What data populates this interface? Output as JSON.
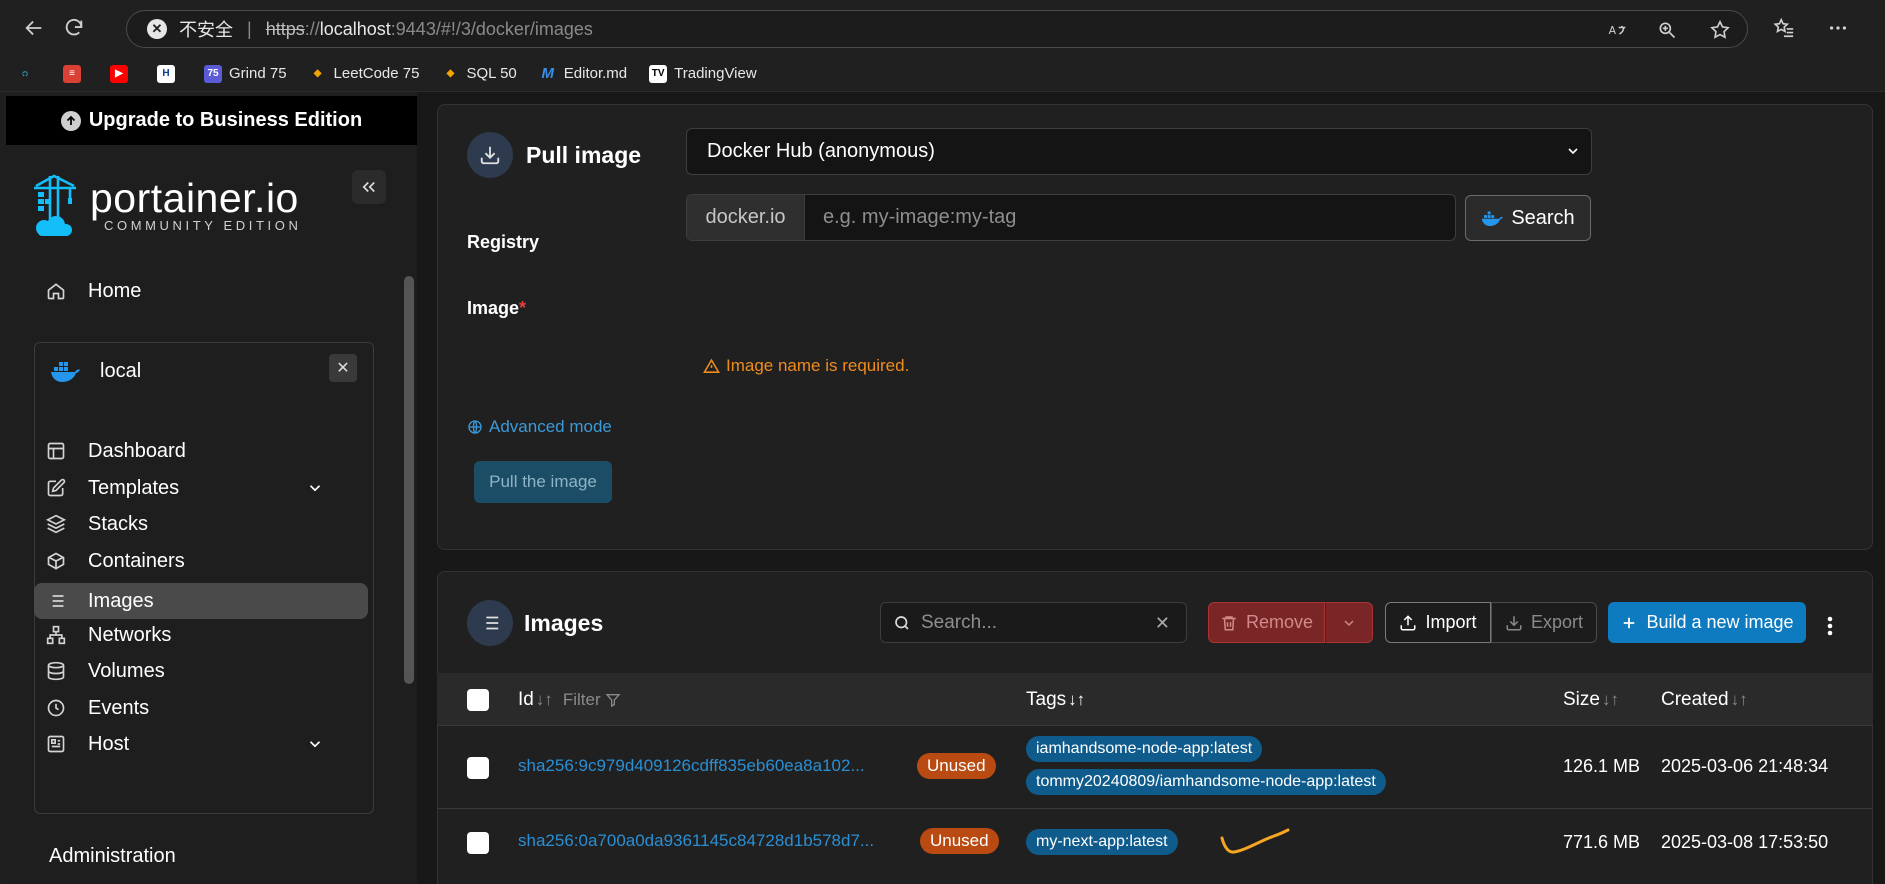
{
  "browser": {
    "security_warning": "不安全",
    "url_scheme": "https",
    "url_sep": "://",
    "url_host": "localhost",
    "url_rest": ":9443/#!/3/docker/images",
    "bookmarks": [
      "Grind 75",
      "LeetCode 75",
      "SQL 50",
      "Editor.md",
      "TradingView"
    ]
  },
  "sidebar": {
    "upgrade_label": "Upgrade to Business Edition",
    "logo_main": "portainer.io",
    "logo_sub": "COMMUNITY EDITION",
    "home": "Home",
    "environment": "local",
    "items": [
      "Dashboard",
      "Templates",
      "Stacks",
      "Containers",
      "Images",
      "Networks",
      "Volumes",
      "Events",
      "Host"
    ],
    "active_item": "Images",
    "admin_heading": "Administration"
  },
  "pull_panel": {
    "title": "Pull image",
    "registry_label": "Registry",
    "registry_value": "Docker Hub (anonymous)",
    "image_label": "Image",
    "required_mark": "*",
    "image_prefix": "docker.io",
    "image_placeholder": "e.g. my-image:my-tag",
    "image_value": "",
    "search_label": "Search",
    "error_text": "Image name is required.",
    "advanced_label": "Advanced mode",
    "pull_button": "Pull the image"
  },
  "images_panel": {
    "title": "Images",
    "search_placeholder": "Search...",
    "remove_label": "Remove",
    "import_label": "Import",
    "export_label": "Export",
    "build_label": "Build a new image",
    "columns": {
      "id": "Id",
      "filter": "Filter",
      "tags": "Tags",
      "size": "Size",
      "created": "Created"
    },
    "sort_glyph": "↓↑",
    "rows": [
      {
        "id": "sha256:9c979d409126cdff835eb60ea8a102...",
        "badge": "Unused",
        "tags": [
          "iamhandsome-node-app:latest",
          "tommy20240809/iamhandsome-node-app:latest"
        ],
        "size": "126.1 MB",
        "created": "2025-03-06 21:48:34"
      },
      {
        "id": "sha256:0a700a0da9361145c84728d1b578d7...",
        "badge": "Unused",
        "tags": [
          "my-next-app:latest"
        ],
        "size": "771.6 MB",
        "created": "2025-03-08 17:53:50"
      }
    ]
  },
  "colors": {
    "accent": "#0e7bc0",
    "badge_unused": "#b84a12",
    "tag_bg": "#0f5c8c",
    "error": "#f08c1e",
    "annotation": "#f5a623"
  }
}
